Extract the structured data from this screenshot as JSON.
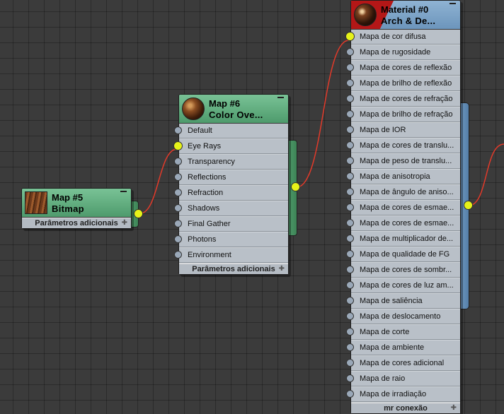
{
  "nodes": {
    "map5": {
      "title": "Map #5",
      "subtitle": "Bitmap",
      "footer": "Parâmetros adicionais"
    },
    "map6": {
      "title": "Map #6",
      "subtitle": "Color  Ove...",
      "slots": [
        "Default",
        "Eye Rays",
        "Transparency",
        "Reflections",
        "Refraction",
        "Shadows",
        "Final Gather",
        "Photons",
        "Environment"
      ],
      "active_slot": 1,
      "footer": "Parâmetros adicionais"
    },
    "material0": {
      "title": "Material #0",
      "subtitle": "Arch  &  De...",
      "slots": [
        "Mapa de cor difusa",
        "Mapa de rugosidade",
        "Mapa de cores de reflexão",
        "Mapa de brilho de reflexão",
        "Mapa de cores de refração",
        "Mapa de brilho de refração",
        "Mapa de IOR",
        "Mapa de cores de translu...",
        "Mapa de peso de translu...",
        "Mapa de anisotropia",
        "Mapa de ângulo de aniso...",
        "Mapa de cores de esmae...",
        "Mapa de cores de esmae...",
        "Mapa de multiplicador de...",
        "Mapa de qualidade de FG",
        "Mapa de cores de sombr...",
        "Mapa de cores de luz am...",
        "Mapa de saliência",
        "Mapa de deslocamento",
        "Mapa de corte",
        "Mapa de ambiente",
        "Mapa de cores adicional",
        "Mapa de raio",
        "Mapa de irradiação"
      ],
      "active_slot": 0,
      "footer": "mr conexão"
    }
  },
  "colors": {
    "wire": "#e23a2a",
    "socket_active": "#e6f219",
    "header_green": "#5ba97a",
    "header_blue": "#7aa3c8"
  }
}
